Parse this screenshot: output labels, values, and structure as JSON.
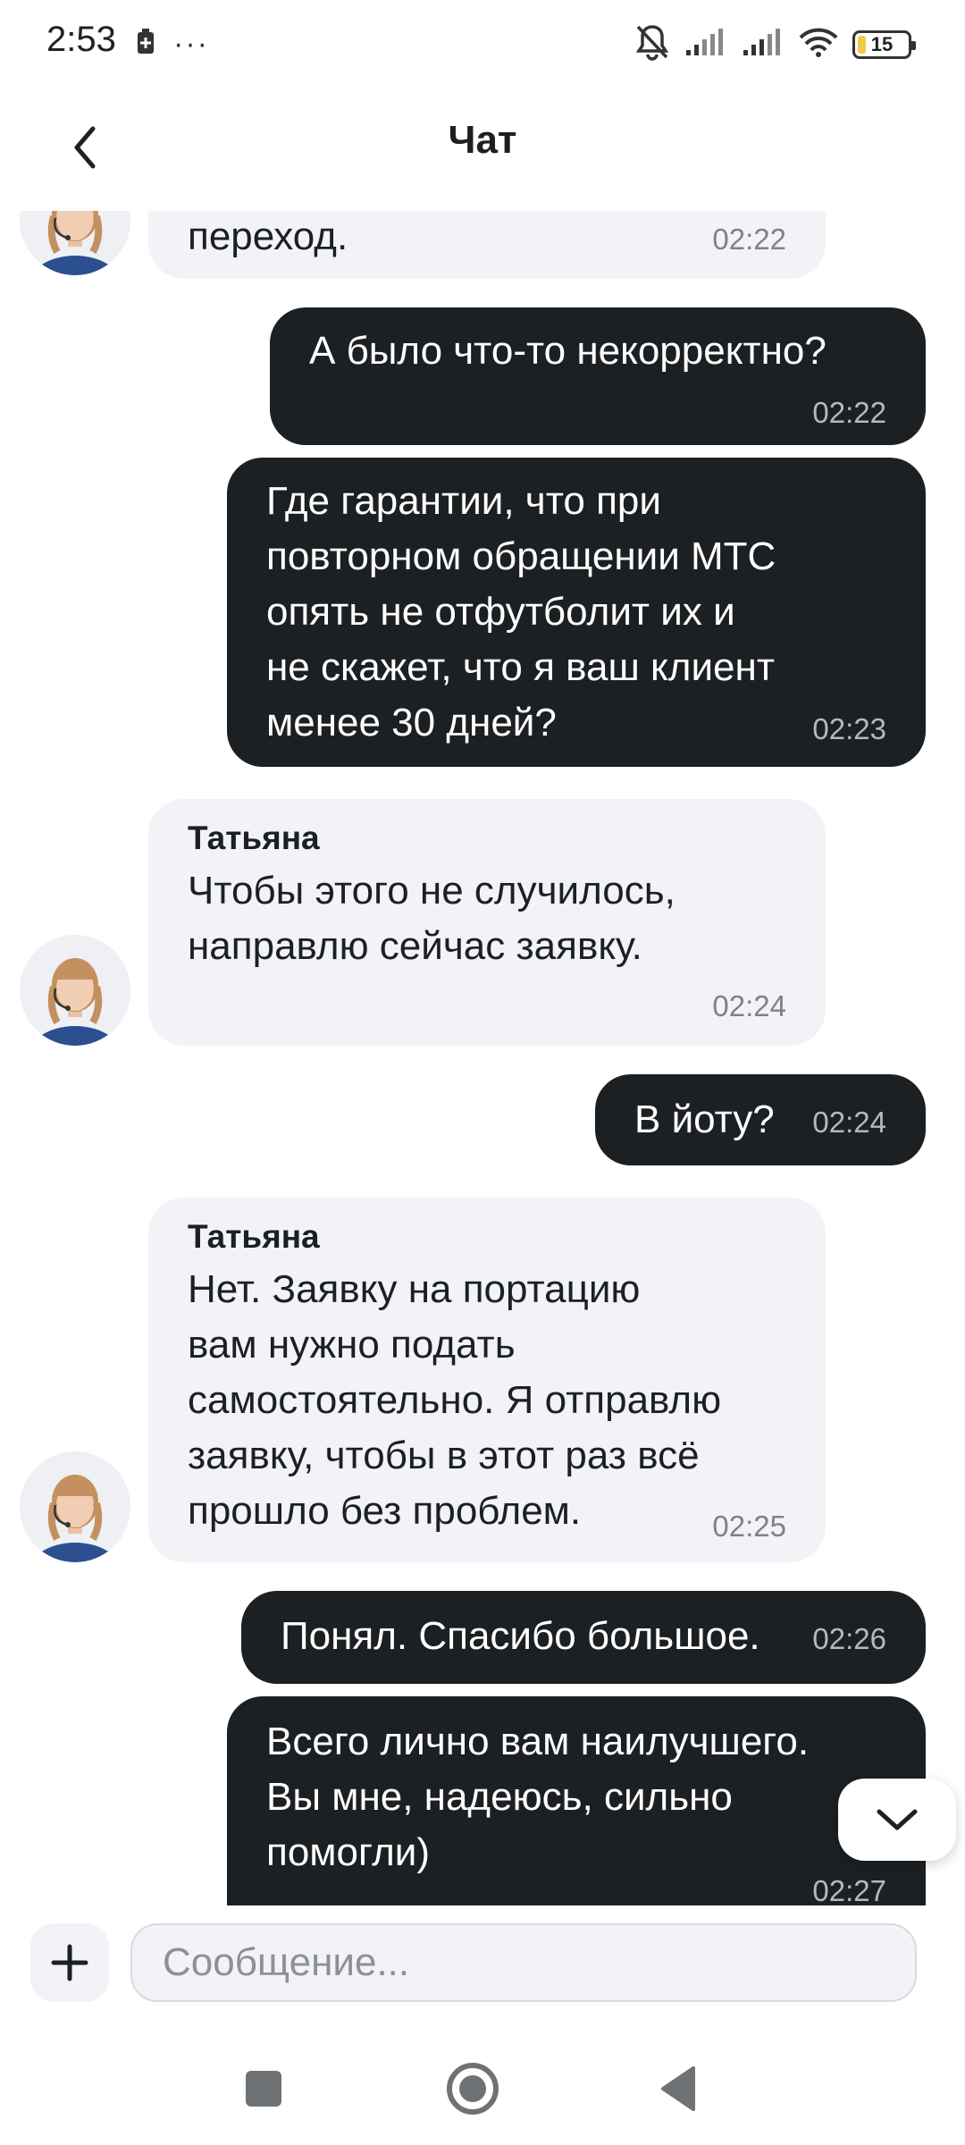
{
  "status_bar": {
    "time": "2:53",
    "overflow": "···",
    "battery": "15",
    "battery_color": "#f2c94c"
  },
  "header": {
    "title": "Чат"
  },
  "colors": {
    "incoming_bubble": "#f2f3f7",
    "outgoing_bubble": "#1d2023"
  },
  "messages": [
    {
      "direction": "in",
      "text": "переход.",
      "time": "02:22"
    },
    {
      "direction": "out",
      "text": "А было что-то некорректно?",
      "time": "02:22"
    },
    {
      "direction": "out",
      "lines": [
        "Где гарантии, что при",
        "повторном обращении МТС",
        "опять не отфутболит их и",
        "не скажет, что я ваш клиент",
        "менее 30 дней?"
      ],
      "time": "02:23"
    },
    {
      "direction": "in",
      "sender": "Татьяна",
      "lines": [
        "Чтобы этого не случилось,",
        "направлю сейчас заявку."
      ],
      "time": "02:24"
    },
    {
      "direction": "out",
      "text": "В йоту?",
      "time": "02:24"
    },
    {
      "direction": "in",
      "sender": "Татьяна",
      "lines": [
        "Нет. Заявку на портацию",
        "вам нужно подать",
        "самостоятельно. Я отправлю",
        "заявку, чтобы в этот раз всё",
        "прошло без проблем."
      ],
      "time": "02:25"
    },
    {
      "direction": "out",
      "text": "Понял. Спасибо большое.",
      "time": "02:26"
    },
    {
      "direction": "out",
      "lines": [
        "Всего лично вам наилучшего.",
        "Вы мне, надеюсь, сильно",
        "помогли)"
      ],
      "time": "02:27"
    }
  ],
  "input": {
    "placeholder": "Сообщение..."
  },
  "icons": {
    "back": "chevron-left-icon",
    "scroll_down": "chevron-down-icon",
    "attach": "plus-icon",
    "nav": [
      "square-icon",
      "home-circle-icon",
      "back-triangle-icon"
    ]
  }
}
